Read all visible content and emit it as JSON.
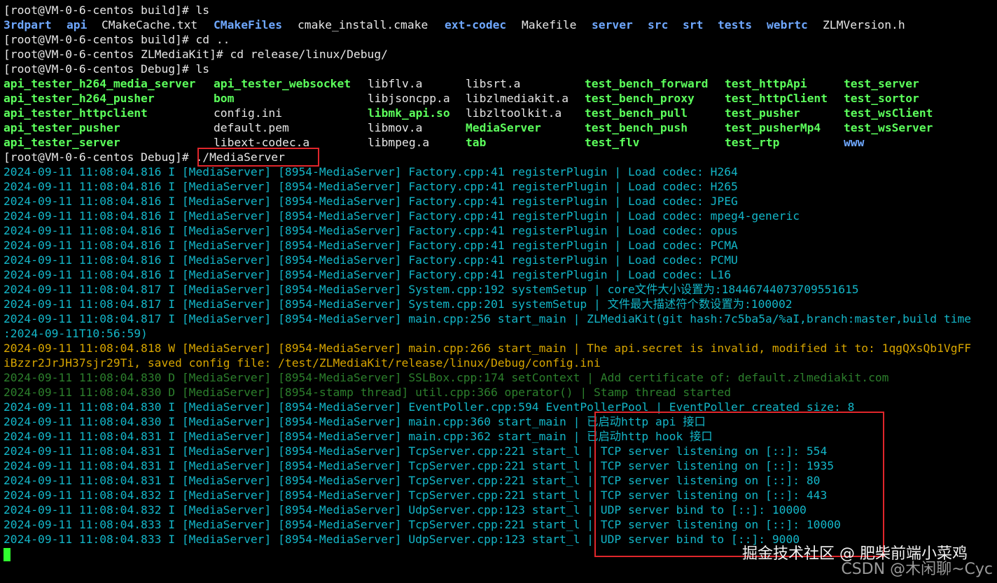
{
  "terminal": {
    "prompt_lines": [
      "[root@VM-0-6-centos build]# ls",
      "[root@VM-0-6-centos build]# cd ..",
      "[root@VM-0-6-centos ZLMediaKit]# cd release/linux/Debug/",
      "[root@VM-0-6-centos Debug]# ls",
      "[root@VM-0-6-centos Debug]# ",
      "./MediaServer"
    ],
    "build_ls": [
      {
        "text": "3rdpart",
        "kind": "dir"
      },
      {
        "text": "api",
        "kind": "dir"
      },
      {
        "text": "CMakeCache.txt",
        "kind": "file"
      },
      {
        "text": "CMakeFiles",
        "kind": "dir"
      },
      {
        "text": "cmake_install.cmake",
        "kind": "file"
      },
      {
        "text": "ext-codec",
        "kind": "dir"
      },
      {
        "text": "Makefile",
        "kind": "file"
      },
      {
        "text": "server",
        "kind": "dir"
      },
      {
        "text": "src",
        "kind": "dir"
      },
      {
        "text": "srt",
        "kind": "dir"
      },
      {
        "text": "tests",
        "kind": "dir"
      },
      {
        "text": "webrtc",
        "kind": "dir"
      },
      {
        "text": "ZLMVersion.h",
        "kind": "file"
      }
    ],
    "debug_ls_rows": [
      [
        {
          "text": "api_tester_h264_media_server",
          "kind": "exec"
        },
        {
          "text": "api_tester_websocket",
          "kind": "exec"
        },
        {
          "text": "libflv.a",
          "kind": "file"
        },
        {
          "text": "libsrt.a",
          "kind": "file"
        },
        {
          "text": "test_bench_forward",
          "kind": "exec"
        },
        {
          "text": "test_httpApi",
          "kind": "exec"
        },
        {
          "text": "test_server",
          "kind": "exec"
        }
      ],
      [
        {
          "text": "api_tester_h264_pusher",
          "kind": "exec"
        },
        {
          "text": "bom",
          "kind": "exec"
        },
        {
          "text": "libjsoncpp.a",
          "kind": "file"
        },
        {
          "text": "libzlmediakit.a",
          "kind": "file"
        },
        {
          "text": "test_bench_proxy",
          "kind": "exec"
        },
        {
          "text": "test_httpClient",
          "kind": "exec"
        },
        {
          "text": "test_sortor",
          "kind": "exec"
        }
      ],
      [
        {
          "text": "api_tester_httpclient",
          "kind": "exec"
        },
        {
          "text": "config.ini",
          "kind": "file"
        },
        {
          "text": "libmk_api.so",
          "kind": "exec"
        },
        {
          "text": "libzltoolkit.a",
          "kind": "file"
        },
        {
          "text": "test_bench_pull",
          "kind": "exec"
        },
        {
          "text": "test_pusher",
          "kind": "exec"
        },
        {
          "text": "test_wsClient",
          "kind": "exec"
        }
      ],
      [
        {
          "text": "api_tester_pusher",
          "kind": "exec"
        },
        {
          "text": "default.pem",
          "kind": "file"
        },
        {
          "text": "libmov.a",
          "kind": "file"
        },
        {
          "text": "MediaServer",
          "kind": "exec"
        },
        {
          "text": "test_bench_push",
          "kind": "exec"
        },
        {
          "text": "test_pusherMp4",
          "kind": "exec"
        },
        {
          "text": "test_wsServer",
          "kind": "exec"
        }
      ],
      [
        {
          "text": "api_tester_server",
          "kind": "exec"
        },
        {
          "text": "libext-codec.a",
          "kind": "file"
        },
        {
          "text": "libmpeg.a",
          "kind": "file"
        },
        {
          "text": "tab",
          "kind": "exec"
        },
        {
          "text": "test_flv",
          "kind": "exec"
        },
        {
          "text": "test_rtp",
          "kind": "exec"
        },
        {
          "text": "www",
          "kind": "dir"
        }
      ]
    ],
    "log_lines": [
      {
        "level": "info",
        "text": "2024-09-11 11:08:04.816 I [MediaServer] [8954-MediaServer] Factory.cpp:41 registerPlugin | Load codec: H264"
      },
      {
        "level": "info",
        "text": "2024-09-11 11:08:04.816 I [MediaServer] [8954-MediaServer] Factory.cpp:41 registerPlugin | Load codec: H265"
      },
      {
        "level": "info",
        "text": "2024-09-11 11:08:04.816 I [MediaServer] [8954-MediaServer] Factory.cpp:41 registerPlugin | Load codec: JPEG"
      },
      {
        "level": "info",
        "text": "2024-09-11 11:08:04.816 I [MediaServer] [8954-MediaServer] Factory.cpp:41 registerPlugin | Load codec: mpeg4-generic"
      },
      {
        "level": "info",
        "text": "2024-09-11 11:08:04.816 I [MediaServer] [8954-MediaServer] Factory.cpp:41 registerPlugin | Load codec: opus"
      },
      {
        "level": "info",
        "text": "2024-09-11 11:08:04.816 I [MediaServer] [8954-MediaServer] Factory.cpp:41 registerPlugin | Load codec: PCMA"
      },
      {
        "level": "info",
        "text": "2024-09-11 11:08:04.816 I [MediaServer] [8954-MediaServer] Factory.cpp:41 registerPlugin | Load codec: PCMU"
      },
      {
        "level": "info",
        "text": "2024-09-11 11:08:04.816 I [MediaServer] [8954-MediaServer] Factory.cpp:41 registerPlugin | Load codec: L16"
      },
      {
        "level": "info",
        "text": "2024-09-11 11:08:04.817 I [MediaServer] [8954-MediaServer] System.cpp:192 systemSetup | core文件大小设置为:18446744073709551615"
      },
      {
        "level": "info",
        "text": "2024-09-11 11:08:04.817 I [MediaServer] [8954-MediaServer] System.cpp:201 systemSetup | 文件最大描述符个数设置为:100002"
      },
      {
        "level": "info",
        "text": "2024-09-11 11:08:04.817 I [MediaServer] [8954-MediaServer] main.cpp:256 start_main | ZLMediaKit(git hash:7c5ba5a/%aI,branch:master,build time"
      },
      {
        "level": "info",
        "text": ":2024-09-11T10:56:59)"
      },
      {
        "level": "warn",
        "text": "2024-09-11 11:08:04.818 W [MediaServer] [8954-MediaServer] main.cpp:266 start_main | The api.secret is invalid, modified it to: 1qgQXsQb1VgFF"
      },
      {
        "level": "warn",
        "text": "iBzzr2JrJH37sjr29Ti, saved config file: /test/ZLMediaKit/release/linux/Debug/config.ini"
      },
      {
        "level": "debug",
        "text": "2024-09-11 11:08:04.830 D [MediaServer] [8954-MediaServer] SSLBox.cpp:174 setContext | Add certificate of: default.zlmediakit.com"
      },
      {
        "level": "debug",
        "text": "2024-09-11 11:08:04.830 D [MediaServer] [8954-stamp thread] util.cpp:366 operator() | Stamp thread started"
      },
      {
        "level": "info",
        "text": "2024-09-11 11:08:04.830 I [MediaServer] [8954-MediaServer] EventPoller.cpp:594 EventPollerPool | EventPoller created size: 8"
      },
      {
        "level": "info",
        "text": "2024-09-11 11:08:04.830 I [MediaServer] [8954-MediaServer] main.cpp:360 start_main | 已启动http api 接口"
      },
      {
        "level": "info",
        "text": "2024-09-11 11:08:04.831 I [MediaServer] [8954-MediaServer] main.cpp:362 start_main | 已启动http hook 接口"
      },
      {
        "level": "info",
        "text": "2024-09-11 11:08:04.831 I [MediaServer] [8954-MediaServer] TcpServer.cpp:221 start_l | TCP server listening on [::]: 554"
      },
      {
        "level": "info",
        "text": "2024-09-11 11:08:04.831 I [MediaServer] [8954-MediaServer] TcpServer.cpp:221 start_l | TCP server listening on [::]: 1935"
      },
      {
        "level": "info",
        "text": "2024-09-11 11:08:04.831 I [MediaServer] [8954-MediaServer] TcpServer.cpp:221 start_l | TCP server listening on [::]: 80"
      },
      {
        "level": "info",
        "text": "2024-09-11 11:08:04.832 I [MediaServer] [8954-MediaServer] TcpServer.cpp:221 start_l | TCP server listening on [::]: 443"
      },
      {
        "level": "info",
        "text": "2024-09-11 11:08:04.832 I [MediaServer] [8954-MediaServer] UdpServer.cpp:123 start_l | UDP server bind to [::]: 10000"
      },
      {
        "level": "info",
        "text": "2024-09-11 11:08:04.833 I [MediaServer] [8954-MediaServer] TcpServer.cpp:221 start_l | TCP server listening on [::]: 10000"
      },
      {
        "level": "info",
        "text": "2024-09-11 11:08:04.833 I [MediaServer] [8954-MediaServer] UdpServer.cpp:123 start_l | UDP server bind to [::]: 9000"
      }
    ]
  },
  "watermark": {
    "line1": "掘金技术社区 @ 肥柴前端小菜鸡",
    "line2": "CSDN @木闲聊~Cyc"
  },
  "colors": {
    "background": "#000000",
    "text": "#e6e6e6",
    "directory": "#6fa8ff",
    "executable": "#5cff5c",
    "info_log": "#13b6c8",
    "warn_log": "#d7a500",
    "debug_log": "#2c7f2c",
    "highlight_box": "#e0262b",
    "cursor": "#2fff2f"
  }
}
